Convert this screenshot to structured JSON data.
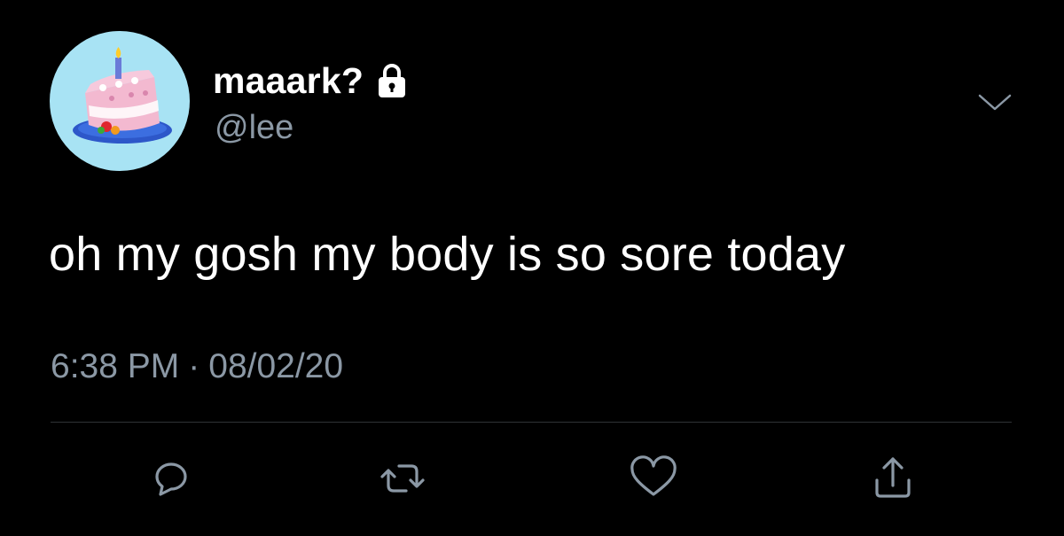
{
  "tweet": {
    "display_name": "maaark?",
    "handle": "@lee",
    "text": "oh my gosh my body is so sore today",
    "time": "6:38 PM",
    "separator": "·",
    "date": "08/02/20",
    "protected_icon": "lock-icon",
    "avatar_icon": "birthday-cake-avatar"
  },
  "actions": {
    "reply": "reply-icon",
    "retweet": "retweet-icon",
    "like": "heart-icon",
    "share": "share-icon",
    "more": "chevron-down-icon"
  },
  "colors": {
    "background": "#000000",
    "text": "#ffffff",
    "secondary": "#8b98a5",
    "divider": "#2f3336",
    "avatar_bg": "#a8e3f4"
  }
}
